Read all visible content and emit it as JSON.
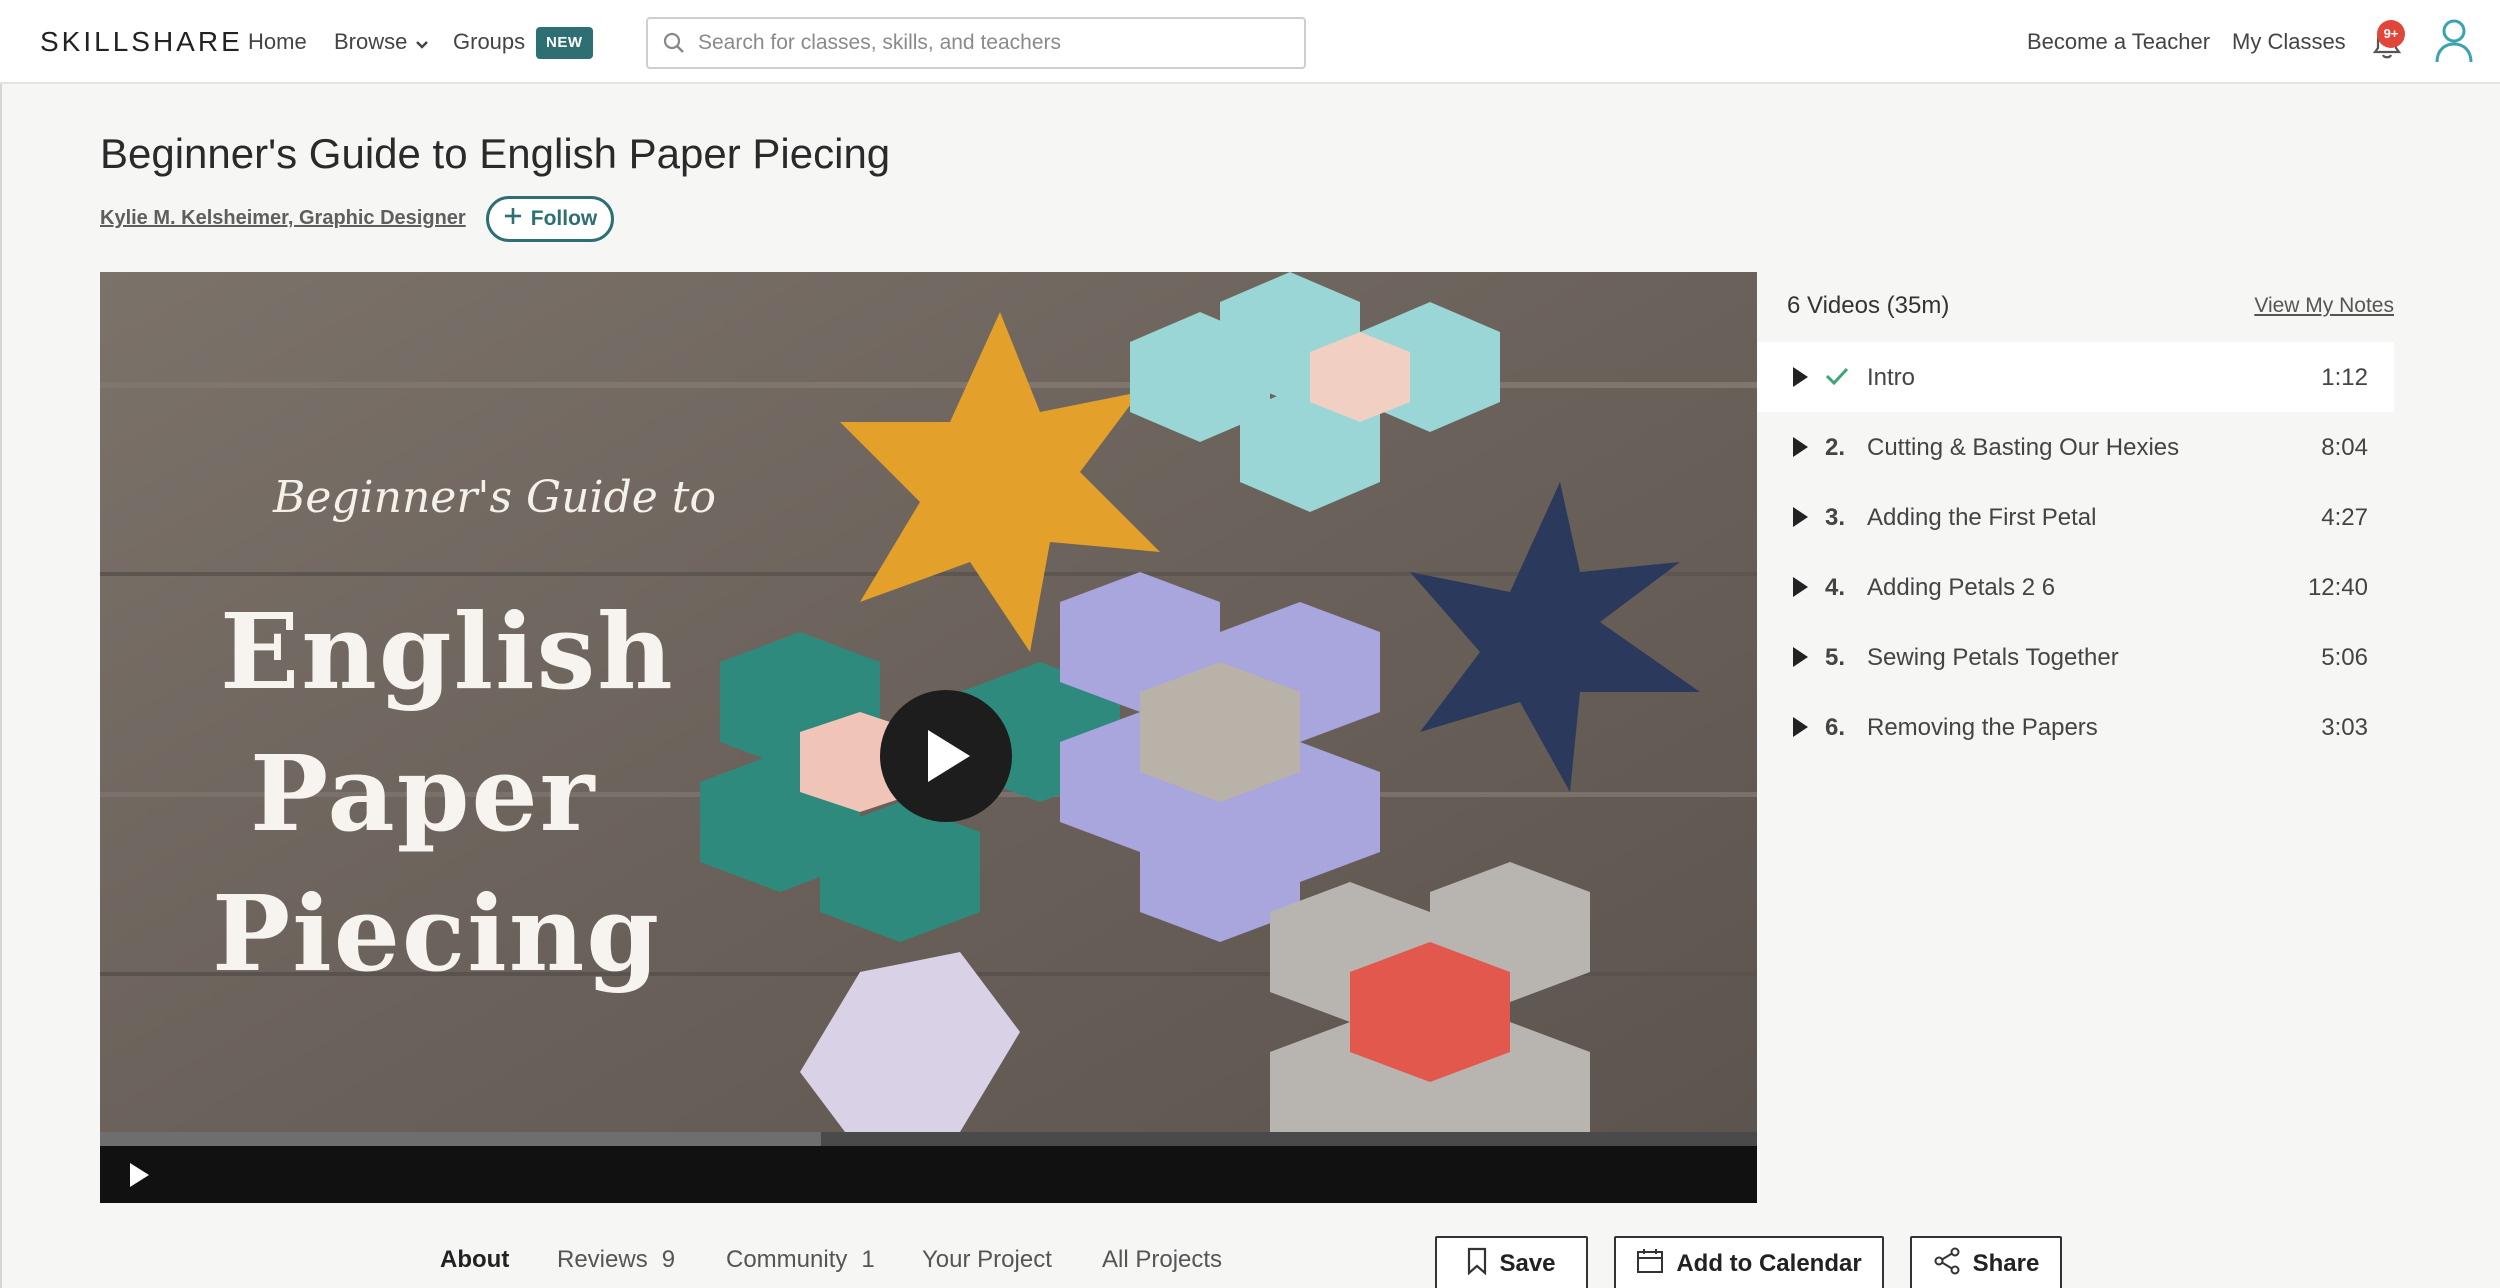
{
  "nav": {
    "logo": "SKILLSHARE",
    "home": "Home",
    "browse": "Browse",
    "groups": "Groups",
    "new_badge": "NEW",
    "search_placeholder": "Search for classes, skills, and teachers",
    "become_teacher": "Become a Teacher",
    "my_classes": "My Classes",
    "notification_count": "9+"
  },
  "class": {
    "title": "Beginner's Guide to English Paper Piecing",
    "teacher": "Kylie M. Kelsheimer, Graphic Designer",
    "follow_label": "Follow"
  },
  "video": {
    "overlay_small": "Beginner's Guide to",
    "overlay_line1": "English",
    "overlay_line2": "Paper",
    "overlay_line3": "Piecing",
    "progress": 0.435
  },
  "lessons": {
    "summary": "6 Videos (35m)",
    "view_notes": "View My Notes",
    "items": [
      {
        "num": "",
        "title": "Intro",
        "duration": "1:12",
        "completed": true,
        "active": true
      },
      {
        "num": "2.",
        "title": "Cutting & Basting Our Hexies",
        "duration": "8:04",
        "completed": false,
        "active": false
      },
      {
        "num": "3.",
        "title": "Adding the First Petal",
        "duration": "4:27",
        "completed": false,
        "active": false
      },
      {
        "num": "4.",
        "title": "Adding Petals 2 6",
        "duration": "12:40",
        "completed": false,
        "active": false
      },
      {
        "num": "5.",
        "title": "Sewing Petals Together",
        "duration": "5:06",
        "completed": false,
        "active": false
      },
      {
        "num": "6.",
        "title": "Removing the Papers",
        "duration": "3:03",
        "completed": false,
        "active": false
      }
    ]
  },
  "tabs": {
    "about": "About",
    "reviews": "Reviews",
    "reviews_count": "9",
    "community": "Community",
    "community_count": "1",
    "your_project": "Your Project",
    "all_projects": "All Projects"
  },
  "actions": {
    "save": "Save",
    "calendar": "Add to Calendar",
    "share": "Share"
  },
  "colors": {
    "accent": "#2e6f73",
    "notification": "#e0463a",
    "check": "#3aa776"
  }
}
